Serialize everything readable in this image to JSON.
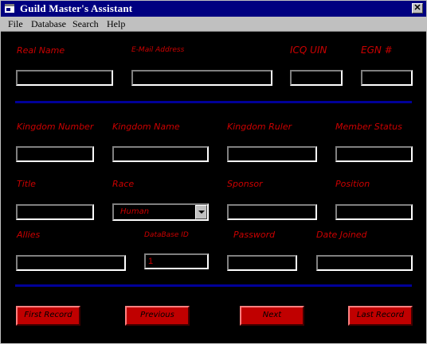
{
  "window": {
    "title": "Guild Master's Assistant"
  },
  "menu": [
    "File",
    "Database",
    "Search",
    "Help"
  ],
  "labels": {
    "real_name": "Real Name",
    "email": "E-Mail Address",
    "icq_uin": "ICQ UIN",
    "egn": "EGN #",
    "kingdom_number": "Kingdom Number",
    "kingdom_name": "Kingdom Name",
    "kingdom_ruler": "Kingdom Ruler",
    "member_status": "Member Status",
    "title": "Title",
    "race": "Race",
    "sponsor": "Sponsor",
    "position": "Position",
    "allies": "Allies",
    "database_id": "DataBase ID",
    "password": "Password",
    "date_joined": "Date Joined"
  },
  "fields": {
    "real_name": "",
    "email": "",
    "icq_uin": "",
    "egn": "",
    "kingdom_number": "",
    "kingdom_name": "",
    "kingdom_ruler": "",
    "member_status": "",
    "title": "",
    "race": "Human",
    "sponsor": "",
    "position": "",
    "allies": "",
    "database_id": "1",
    "password": "",
    "date_joined": ""
  },
  "buttons": {
    "first": "First Record",
    "previous": "Previous",
    "next": "Next",
    "last": "Last Record"
  },
  "colors": {
    "label": "#cc0000",
    "separator": "#000099",
    "button": "#c00000"
  }
}
